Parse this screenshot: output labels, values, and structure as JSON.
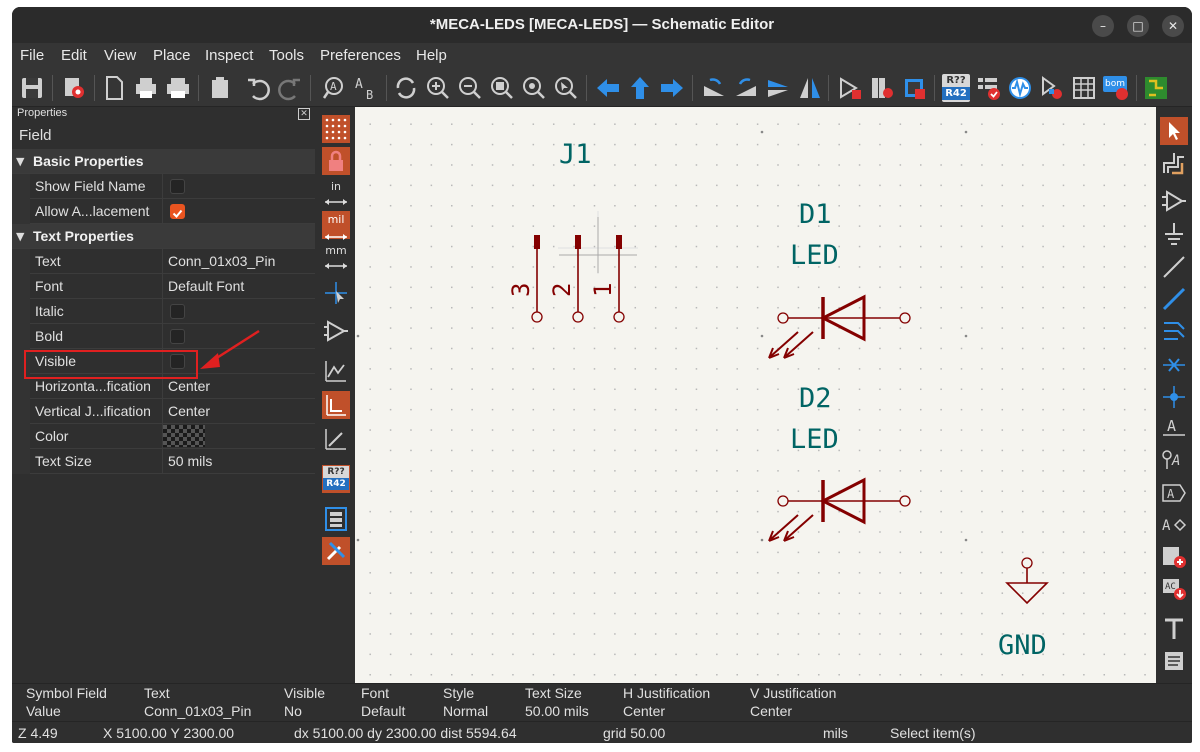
{
  "window": {
    "title": "*MECA-LEDS [MECA-LEDS] — Schematic Editor",
    "minimize_glyph": "–",
    "maximize_glyph": "□",
    "close_glyph": "✕"
  },
  "menu": [
    "File",
    "Edit",
    "View",
    "Place",
    "Inspect",
    "Tools",
    "Preferences",
    "Help"
  ],
  "properties": {
    "panel_title": "Properties",
    "close_glyph": "✕",
    "field_label": "Field",
    "basic_header": "Basic Properties",
    "text_header": "Text Properties",
    "rows": {
      "show_field_name": {
        "name": "Show Field Name",
        "checked": false
      },
      "allow_autoplacement": {
        "name": "Allow A...lacement",
        "checked": true
      },
      "text": {
        "name": "Text",
        "value": "Conn_01x03_Pin"
      },
      "font": {
        "name": "Font",
        "value": "Default Font"
      },
      "italic": {
        "name": "Italic",
        "checked": false
      },
      "bold": {
        "name": "Bold",
        "checked": false
      },
      "visible": {
        "name": "Visible",
        "checked": false
      },
      "h_justification": {
        "name": "Horizonta...fication",
        "value": "Center"
      },
      "v_justification": {
        "name": "Vertical J...ification",
        "value": "Center"
      },
      "color": {
        "name": "Color"
      },
      "text_size": {
        "name": "Text Size",
        "value": "50 mils"
      }
    }
  },
  "left_toolbar": {
    "in_label": "in",
    "mil_label": "mil",
    "mm_label": "mm",
    "annotate_top": "R??",
    "annotate_bottom": "R42"
  },
  "main_toolbar": {
    "annotate_top": "R??",
    "annotate_bottom": "R42",
    "bom_label": "bom"
  },
  "schematic": {
    "j1_ref": "J1",
    "pin3": "3",
    "pin2": "2",
    "pin1": "1",
    "d1_ref": "D1",
    "d1_value": "LED",
    "d2_ref": "D2",
    "d2_value": "LED",
    "gnd_label": "GND",
    "colors": {
      "symbol": "#840000",
      "text": "#006464",
      "background": "#f5f4ef"
    }
  },
  "message_panel": {
    "symbol_field_label": "Symbol Field",
    "symbol_field_value": "Value",
    "text_label": "Text",
    "text_value": "Conn_01x03_Pin",
    "visible_label": "Visible",
    "visible_value": "No",
    "font_label": "Font",
    "font_value": "Default",
    "style_label": "Style",
    "style_value": "Normal",
    "text_size_label": "Text Size",
    "text_size_value": "50.00 mils",
    "h_just_label": "H Justification",
    "h_just_value": "Center",
    "v_just_label": "V Justification",
    "v_just_value": "Center"
  },
  "status": {
    "zoom": "Z 4.49",
    "cursor": "X 5100.00  Y 2300.00",
    "delta": "dx 5100.00  dy 2300.00  dist 5594.64",
    "grid": "grid 50.00",
    "units": "mils",
    "message": "Select item(s)"
  }
}
